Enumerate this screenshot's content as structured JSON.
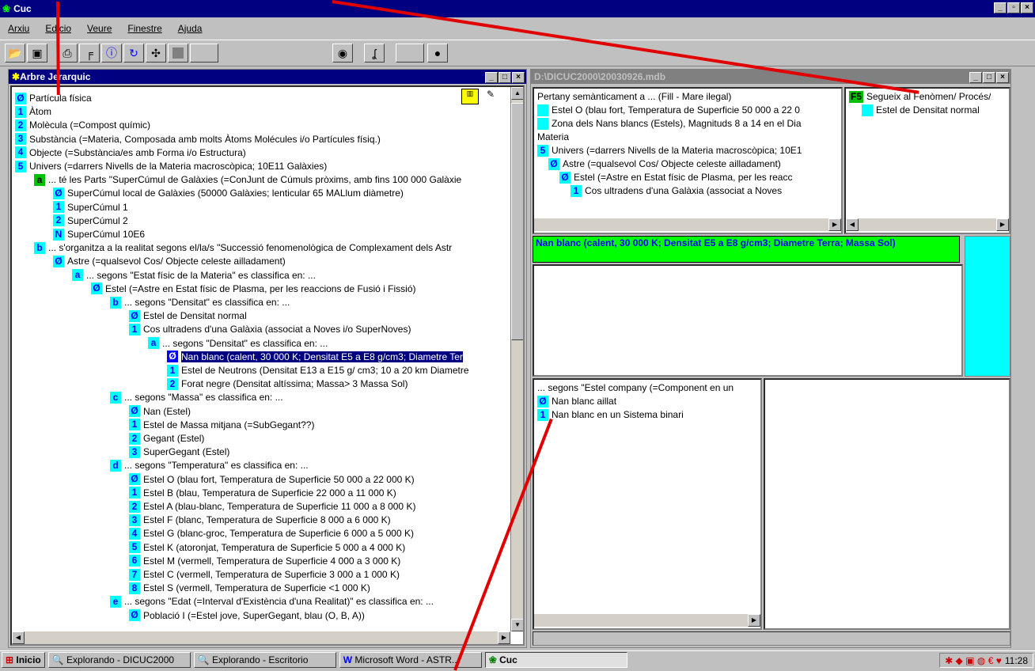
{
  "app": {
    "title": "Cuc",
    "menus": [
      "Arxiu",
      "Edicio",
      "Veure",
      "Finestre",
      "Ajuda"
    ]
  },
  "tree_window": {
    "title": "Arbre Jerarquic"
  },
  "tree": [
    {
      "l": 0,
      "b": "Ø",
      "t": "Partícula física"
    },
    {
      "l": 0,
      "b": "1",
      "t": "Àtom"
    },
    {
      "l": 0,
      "b": "2",
      "t": "Molècula (=Compost químic)"
    },
    {
      "l": 0,
      "b": "3",
      "t": "Substància (=Materia, Composada amb molts Àtoms Molécules i/o Partícules físiq.)"
    },
    {
      "l": 0,
      "b": "4",
      "t": "Objecte (=Substància/es amb Forma i/o Estructura)"
    },
    {
      "l": 0,
      "b": "5",
      "t": "Univers (=darrers Nivells de la Materia macroscòpica; 10E11 Galàxies)"
    },
    {
      "l": 1,
      "b": "a",
      "g": 1,
      "t": "... té les Parts \"SuperCúmul de Galàxies (=ConJunt de Cúmuls pròxims, amb fins 100 000 Galàxie"
    },
    {
      "l": 2,
      "b": "Ø",
      "t": "SuperCúmul local de Galàxies (50000 Galàxies; lenticular 65 MALlum diàmetre)"
    },
    {
      "l": 2,
      "b": "1",
      "t": "SuperCúmul 1"
    },
    {
      "l": 2,
      "b": "2",
      "t": "SuperCúmul 2"
    },
    {
      "l": 2,
      "b": "N",
      "t": "SuperCúmul 10E6"
    },
    {
      "l": 1,
      "b": "b",
      "t": "... s'organitza a la realitat segons el/la/s \"Successió fenomenològica de Complexament dels Astr"
    },
    {
      "l": 2,
      "b": "Ø",
      "t": "Astre (=qualsevol Cos/ Objecte celeste ailladament)"
    },
    {
      "l": 3,
      "b": "a",
      "t": "... segons \"Estat físic de la Materia\" es classifica en: ..."
    },
    {
      "l": 4,
      "b": "Ø",
      "t": "Estel (=Astre en Estat físic de Plasma, per les reaccions de Fusió i Fissió)"
    },
    {
      "l": 5,
      "b": "b",
      "t": "... segons \"Densitat\" es classifica en: ..."
    },
    {
      "l": 6,
      "b": "Ø",
      "t": "Estel de Densitat normal"
    },
    {
      "l": 6,
      "b": "1",
      "t": "Cos ultradens d'una Galàxia (associat a Noves i/o SuperNoves)"
    },
    {
      "l": 7,
      "b": "a",
      "t": "... segons \"Densitat\" es classifica en: ..."
    },
    {
      "l": 8,
      "b": "Ø",
      "s": 1,
      "t": "Nan blanc (calent, 30 000 K; Densitat E5 a E8 g/cm3; Diametre Ter"
    },
    {
      "l": 8,
      "b": "1",
      "t": "Estel de Neutrons (Densitat E13 a E15 g/ cm3; 10 a 20 km Diametre"
    },
    {
      "l": 8,
      "b": "2",
      "t": "Forat negre (Densitat altíssima; Massa> 3 Massa Sol)"
    },
    {
      "l": 5,
      "b": "c",
      "t": "... segons \"Massa\" es classifica en: ..."
    },
    {
      "l": 6,
      "b": "Ø",
      "t": "Nan (Estel)"
    },
    {
      "l": 6,
      "b": "1",
      "t": "Estel de Massa mitjana (=SubGegant??)"
    },
    {
      "l": 6,
      "b": "2",
      "t": "Gegant (Estel)"
    },
    {
      "l": 6,
      "b": "3",
      "t": "SuperGegant (Estel)"
    },
    {
      "l": 5,
      "b": "d",
      "t": "... segons \"Temperatura\" es classifica en: ..."
    },
    {
      "l": 6,
      "b": "Ø",
      "t": "Estel O (blau fort, Temperatura de Superficie 50 000 a 22 000 K)"
    },
    {
      "l": 6,
      "b": "1",
      "t": "Estel B (blau, Temperatura de Superficie 22 000 a 11 000 K)"
    },
    {
      "l": 6,
      "b": "2",
      "t": "Estel A (blau-blanc, Temperatura de Superficie 11 000 a 8 000 K)"
    },
    {
      "l": 6,
      "b": "3",
      "t": "Estel F (blanc, Temperatura de Superficie 8 000 a 6 000 K)"
    },
    {
      "l": 6,
      "b": "4",
      "t": "Estel G (blanc-groc, Temperatura de Superficie 6 000 a 5 000 K)"
    },
    {
      "l": 6,
      "b": "5",
      "t": "Estel K (atoronjat, Temperatura de Superficie 5 000 a 4 000 K)"
    },
    {
      "l": 6,
      "b": "6",
      "t": "Estel M (vermell, Temperatura de Superficie 4 000 a 3 000 K)"
    },
    {
      "l": 6,
      "b": "7",
      "t": "Estel C (vermell, Temperatura de Superficie 3 000 a 1 000 K)"
    },
    {
      "l": 6,
      "b": "8",
      "t": "Estel S (vermell, Temperatura de Superficie <1 000 K)"
    },
    {
      "l": 5,
      "b": "e",
      "t": "... segons \"Edat (=Interval d'Existència d'una Realitat)\" es classifica en: ..."
    },
    {
      "l": 6,
      "b": "Ø",
      "t": "Població I (=Estel jove, SuperGegant, blau (O, B, A))"
    }
  ],
  "db_window": {
    "title": "D:\\DICUC2000\\20030926.mdb"
  },
  "semantic": [
    {
      "l": 0,
      "b": "",
      "t": "Pertany semànticament a ... (Fill - Mare ilegal)"
    },
    {
      "l": 0,
      "b": " ",
      "t": "Estel O (blau fort, Temperatura de Superficie 50 000 a 22 0"
    },
    {
      "l": 0,
      "b": " ",
      "t": "Zona dels Nans blancs (Estels), Magnituds 8 a 14 en el Dia"
    },
    {
      "l": 0,
      "b": "",
      "t": "Materia"
    },
    {
      "l": 0,
      "b": "5",
      "t": "Univers (=darrers Nivells de la Materia macroscòpica; 10E1"
    },
    {
      "l": 1,
      "b": "Ø",
      "t": "Astre (=qualsevol Cos/ Objecte celeste ailladament)"
    },
    {
      "l": 2,
      "b": "Ø",
      "t": "Estel (=Astre en Estat físic de Plasma, per les reacc"
    },
    {
      "l": 3,
      "b": "1",
      "t": "Cos ultradens d'una Galàxia (associat a Noves"
    }
  ],
  "phenomenon": [
    {
      "l": 0,
      "b": "F5",
      "g": 1,
      "t": "Segueix al Fenòmen/ Procés/"
    },
    {
      "l": 1,
      "b": " ",
      "t": "Estel de Densitat normal"
    }
  ],
  "selected_name": "Nan blanc (calent, 30 000 K; Densitat E5 a E8 g/cm3; Diametre Terra; Massa Sol)",
  "companion": [
    {
      "l": 0,
      "b": "",
      "t": "... segons \"Estel company (=Component en un"
    },
    {
      "l": 0,
      "b": "Ø",
      "t": "Nan blanc aillat"
    },
    {
      "l": 0,
      "b": "1",
      "t": "Nan blanc en un Sistema binari"
    }
  ],
  "taskbar": {
    "start": "Inicio",
    "tasks": [
      "Explorando - DICUC2000",
      "Explorando - Escritorio",
      "Microsoft Word - ASTR...",
      "Cuc"
    ],
    "clock": "11:28"
  },
  "colors": {
    "cyan": "#00ffff",
    "green": "#00ff00",
    "titlebar": "#000080",
    "arrow": "#e00000"
  }
}
